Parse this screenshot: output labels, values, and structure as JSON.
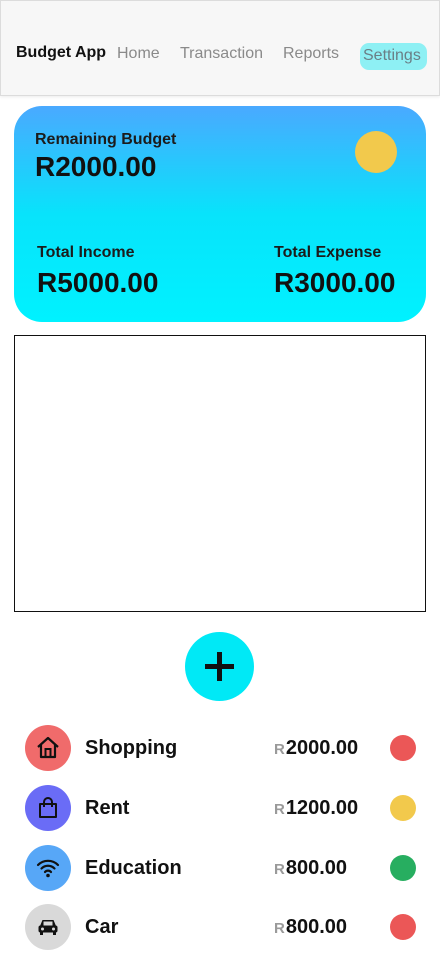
{
  "header": {
    "brand": "Budget App",
    "nav": {
      "home": "Home",
      "transaction": "Transaction",
      "reports": "Reports",
      "settings": "Settings"
    }
  },
  "summary": {
    "remaining_label": "Remaining Budget",
    "remaining_value": "R2000.00",
    "status_color": "#f2c94c",
    "income_label": "Total Income",
    "income_value": "R5000.00",
    "expense_label": "Total Expense",
    "expense_value": "R3000.00"
  },
  "expenses": [
    {
      "name": "Shopping",
      "currency": "R",
      "amount": "2000.00",
      "icon": "house-icon",
      "icon_bg": "#f06b6b",
      "status_color": "#eb5757"
    },
    {
      "name": "Rent",
      "currency": "R",
      "amount": "1200.00",
      "icon": "shopping-bag-icon",
      "icon_bg": "#6a6cf6",
      "status_color": "#f2c94c"
    },
    {
      "name": "Education",
      "currency": "R",
      "amount": "800.00",
      "icon": "wifi-icon",
      "icon_bg": "#57a7f7",
      "status_color": "#27ae60"
    },
    {
      "name": "Car",
      "currency": "R",
      "amount": "800.00",
      "icon": "car-icon",
      "icon_bg": "#d9d9d9",
      "status_color": "#eb5757"
    }
  ],
  "colors": {
    "accent": "#00e9f6",
    "card_gradient_top": "#4aa9ff",
    "card_gradient_bottom": "#00f2ff",
    "settings_highlight": "#8ef0f4"
  }
}
